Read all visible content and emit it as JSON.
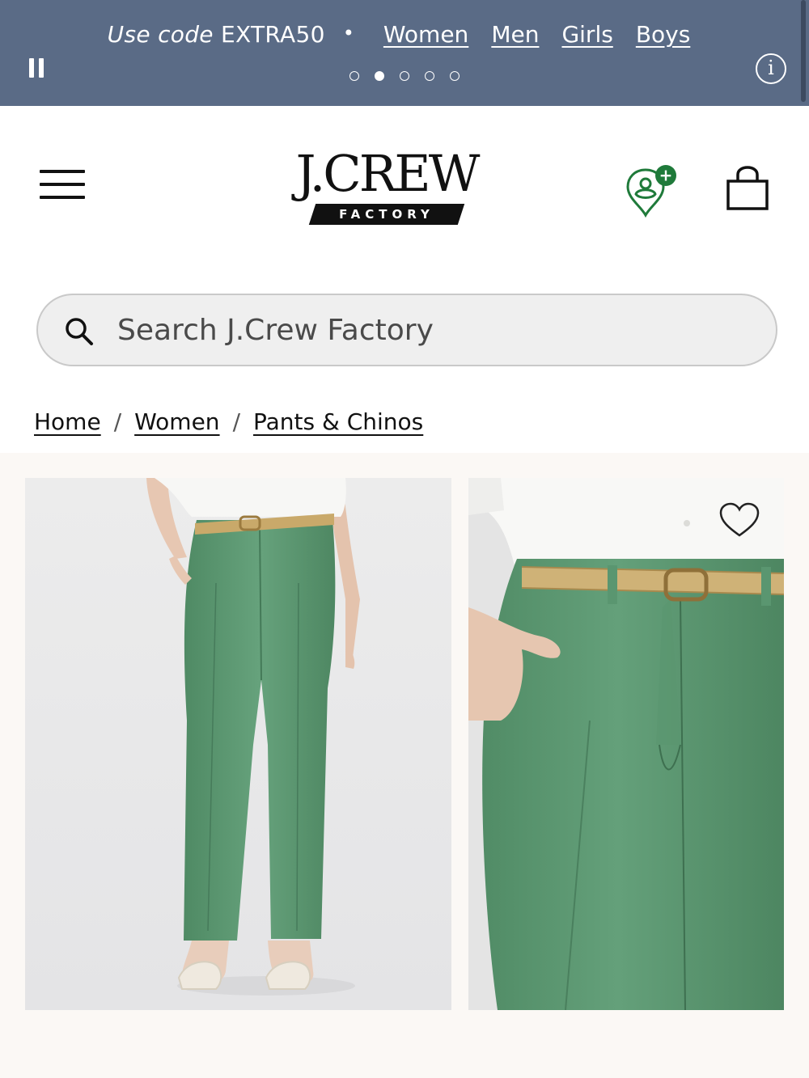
{
  "promo": {
    "code_prefix": "Use code",
    "code": "EXTRA50",
    "separator": "•",
    "links": [
      "Women",
      "Men",
      "Girls",
      "Boys"
    ],
    "slide_count": 5,
    "active_slide": 2,
    "info_label": "i"
  },
  "header": {
    "logo_text": "J.CREW",
    "logo_sub": "FACTORY",
    "rewards_badge": "+"
  },
  "search": {
    "placeholder": "Search J.Crew Factory"
  },
  "breadcrumb": {
    "items": [
      "Home",
      "Women",
      "Pants & Chinos"
    ],
    "separator": "/"
  },
  "colors": {
    "promo_bg": "#5a6b86",
    "pants_green": "#5f9a74",
    "rewards_green": "#1f7a3a",
    "gallery_bg": "#fbf8f5"
  },
  "icons": [
    "pause-icon",
    "info-icon",
    "menu-icon",
    "rewards-icon",
    "bag-icon",
    "search-icon",
    "heart-icon"
  ]
}
